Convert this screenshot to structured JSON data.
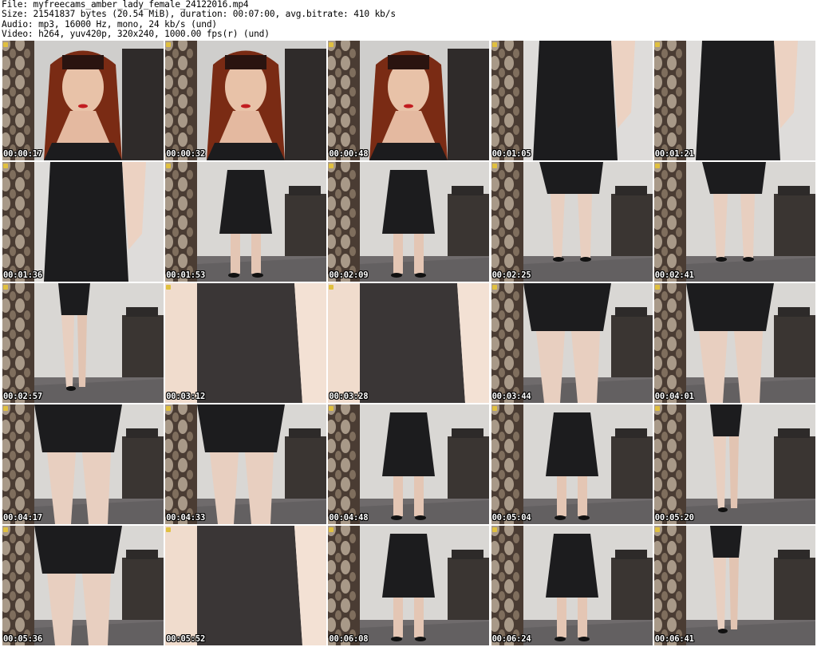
{
  "header": {
    "file": "File: myfreecams_amber_lady_female_24122016.mp4",
    "size": "Size: 21541837 bytes (20.54 MiB), duration: 00:07:00, avg.bitrate: 410 kb/s",
    "audio": "Audio: mp3, 16000 Hz, mono, 24 kb/s (und)",
    "video": "Video: h264, yuv420p, 320x240, 1000.00 fps(r) (und)"
  },
  "colors": {
    "background": "#ffffff",
    "timestamp_text": "#ffffff",
    "timestamp_outline": "#000000",
    "dress": "#1c1c1e",
    "wall": "#dcdcdc"
  },
  "thumbnails": [
    {
      "time": "00:00:17",
      "scene": "face"
    },
    {
      "time": "00:00:32",
      "scene": "face"
    },
    {
      "time": "00:00:48",
      "scene": "face"
    },
    {
      "time": "00:01:05",
      "scene": "torso"
    },
    {
      "time": "00:01:21",
      "scene": "torso"
    },
    {
      "time": "00:01:36",
      "scene": "torso"
    },
    {
      "time": "00:01:53",
      "scene": "full"
    },
    {
      "time": "00:02:09",
      "scene": "full"
    },
    {
      "time": "00:02:25",
      "scene": "legs"
    },
    {
      "time": "00:02:41",
      "scene": "legs"
    },
    {
      "time": "00:02:57",
      "scene": "side"
    },
    {
      "time": "00:03:12",
      "scene": "skirt"
    },
    {
      "time": "00:03:28",
      "scene": "skirt"
    },
    {
      "time": "00:03:44",
      "scene": "hips"
    },
    {
      "time": "00:04:01",
      "scene": "hips"
    },
    {
      "time": "00:04:17",
      "scene": "hips"
    },
    {
      "time": "00:04:33",
      "scene": "hips"
    },
    {
      "time": "00:04:48",
      "scene": "full"
    },
    {
      "time": "00:05:04",
      "scene": "full"
    },
    {
      "time": "00:05:20",
      "scene": "side"
    },
    {
      "time": "00:05:36",
      "scene": "hips"
    },
    {
      "time": "00:05:52",
      "scene": "skirt"
    },
    {
      "time": "00:06:08",
      "scene": "full"
    },
    {
      "time": "00:06:24",
      "scene": "full"
    },
    {
      "time": "00:06:41",
      "scene": "side"
    }
  ]
}
